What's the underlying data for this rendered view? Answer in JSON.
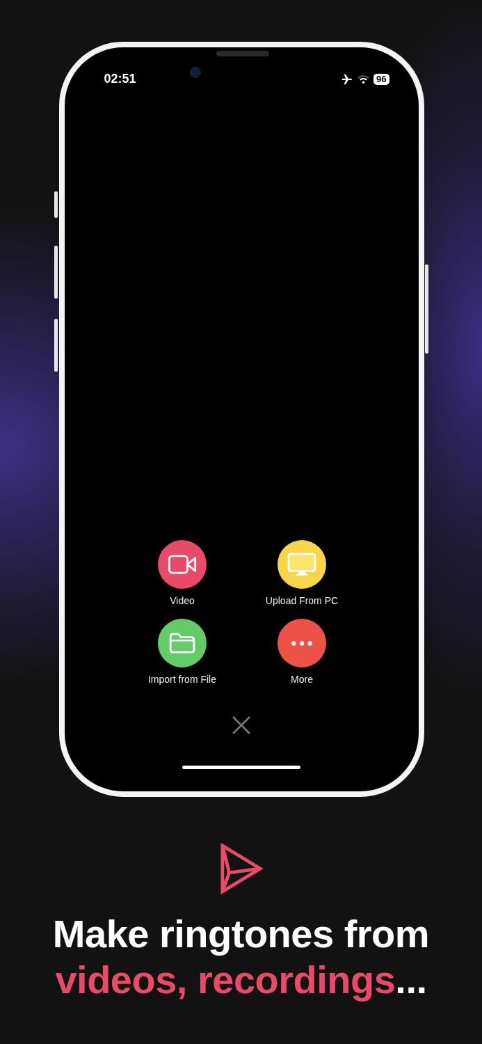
{
  "status_bar": {
    "time": "02:51",
    "battery": "96"
  },
  "actions": [
    {
      "kind": "video",
      "label": "Video",
      "color": "#e84a67"
    },
    {
      "kind": "monitor",
      "label": "Upload From PC",
      "color": "#f7d64a"
    },
    {
      "kind": "folder",
      "label": "Import from File",
      "color": "#62cc68"
    },
    {
      "kind": "more",
      "label": "More",
      "color": "#ec5346"
    }
  ],
  "headline": {
    "line_1": "Make ringtones from",
    "accent": "videos, recordings",
    "tail": "..."
  }
}
